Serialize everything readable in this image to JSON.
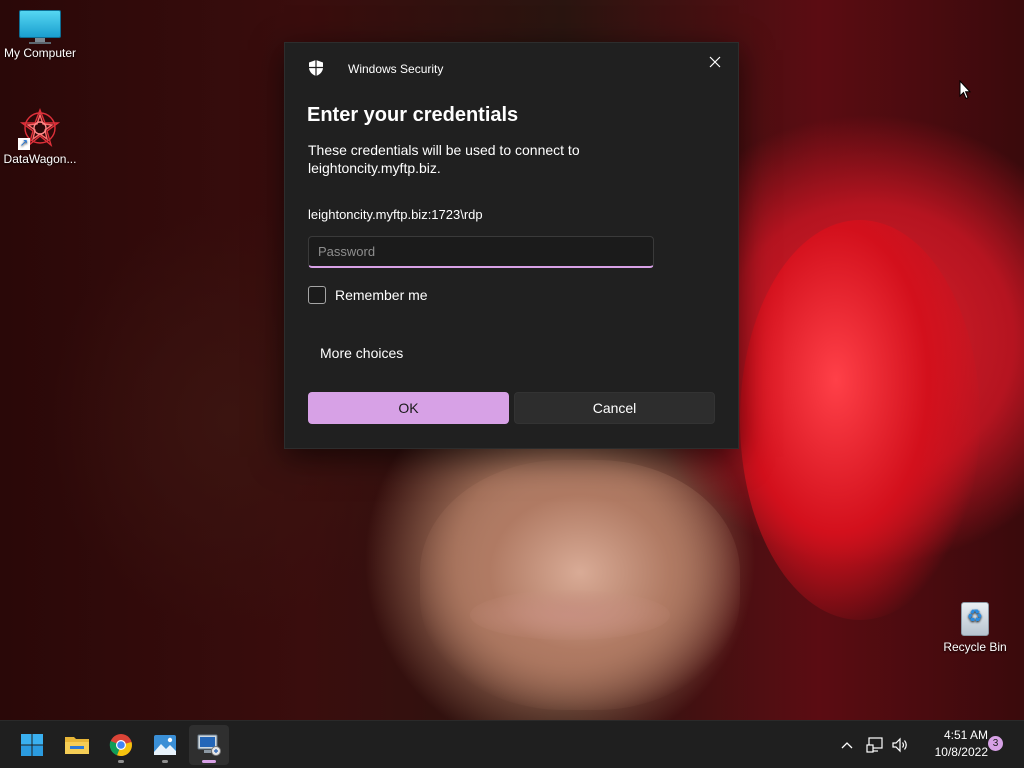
{
  "desktop": {
    "icons": [
      {
        "label": "My Computer"
      },
      {
        "label": "DataWagon..."
      },
      {
        "label": "Recycle Bin"
      }
    ]
  },
  "dialog": {
    "app_title": "Windows Security",
    "heading": "Enter your credentials",
    "description": "These credentials will be used to connect to leightoncity.myftp.biz.",
    "username": "leightoncity.myftp.biz:1723\\rdp",
    "password_placeholder": "Password",
    "password_value": "",
    "remember_label": "Remember me",
    "remember_checked": false,
    "more_choices_label": "More choices",
    "ok_label": "OK",
    "cancel_label": "Cancel",
    "accent_color": "#d7a1e6"
  },
  "taskbar": {
    "apps": [
      {
        "icon": "windows-start-icon"
      },
      {
        "icon": "file-explorer-icon"
      },
      {
        "icon": "chrome-icon"
      },
      {
        "icon": "photos-icon"
      },
      {
        "icon": "remote-desktop-icon"
      }
    ],
    "tray_icons": [
      "chevron-up-icon",
      "network-icon",
      "volume-icon"
    ],
    "time": "4:51 AM",
    "date": "10/8/2022",
    "notification_count": "3"
  }
}
